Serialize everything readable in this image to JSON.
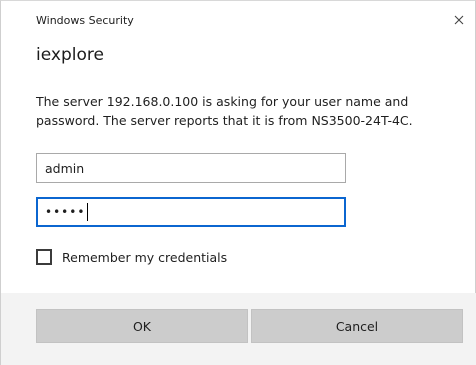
{
  "window": {
    "title": "Windows Security",
    "close_icon": "close-icon"
  },
  "app": {
    "name": "iexplore"
  },
  "message": {
    "line1": "The server 192.168.0.100 is asking for your user name and",
    "line2": "password. The server reports that it is from NS3500-24T-4C."
  },
  "fields": {
    "username": {
      "value": "admin"
    },
    "password": {
      "masked_value": "•••••",
      "focused": true
    }
  },
  "remember": {
    "label": "Remember my credentials",
    "checked": false
  },
  "buttons": {
    "ok": "OK",
    "cancel": "Cancel"
  },
  "colors": {
    "focus_border": "#0b66d0",
    "button_bg": "#cccccc",
    "footer_bg": "#f3f3f3"
  }
}
